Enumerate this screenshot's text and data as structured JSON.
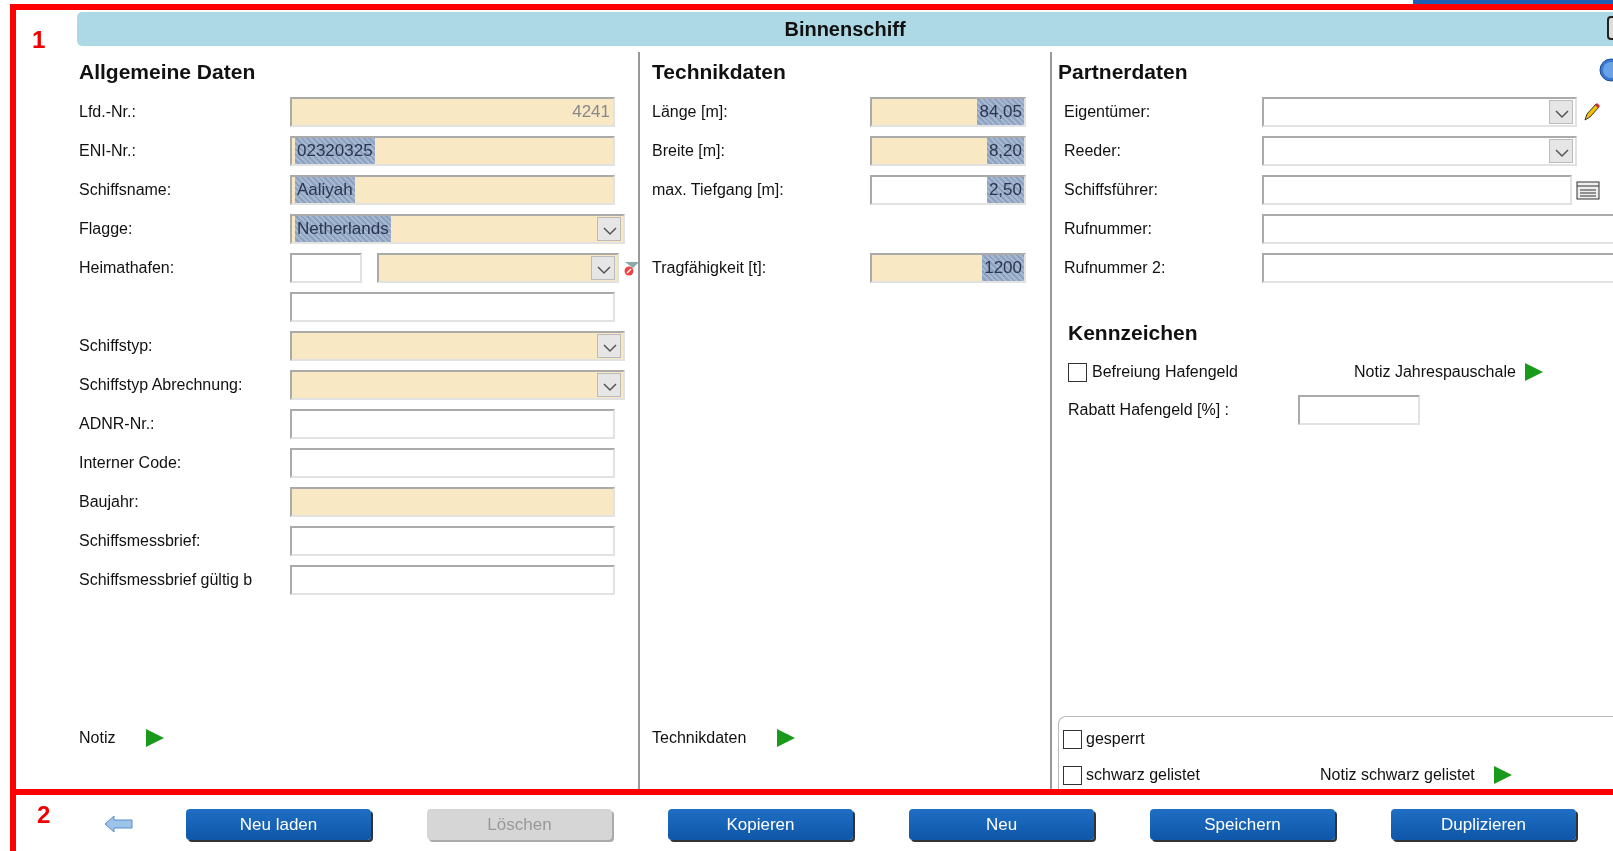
{
  "markers": [
    "1",
    "2"
  ],
  "title": "Binnenschiff",
  "general": {
    "heading": "Allgemeine Daten",
    "rows": [
      {
        "label": "Lfd.-Nr.:",
        "kind": "number",
        "value": "4241",
        "required": true,
        "highlighted": false
      },
      {
        "label": "ENI-Nr.:",
        "kind": "text",
        "value": "02320325",
        "required": true,
        "highlighted": true
      },
      {
        "label": "Schiffsname:",
        "kind": "text",
        "value": "Aaliyah",
        "required": true,
        "highlighted": true
      },
      {
        "label": "Flagge:",
        "kind": "select",
        "value": "Netherlands",
        "required": true,
        "highlighted": true
      },
      {
        "label": "Heimathafen:",
        "kind": "port",
        "fields": [
          {
            "kind": "text",
            "required": false
          },
          {
            "kind": "select",
            "required": true
          }
        ]
      },
      {
        "kind": "text",
        "required": false
      },
      {
        "label": "Schiffstyp:",
        "kind": "select",
        "required": true
      },
      {
        "label": "Schiffstyp Abrechnung:",
        "kind": "select",
        "required": true
      },
      {
        "label": "ADNR-Nr.:",
        "kind": "text",
        "required": false
      },
      {
        "label": "Interner Code:",
        "kind": "text",
        "required": false
      },
      {
        "label": "Baujahr:",
        "kind": "text",
        "required": true
      },
      {
        "label": "Schiffsmessbrief:",
        "kind": "text",
        "required": false
      },
      {
        "label": "Schiffsmessbrief gültig b",
        "kind": "text",
        "required": false
      }
    ],
    "footer_link": "Notiz"
  },
  "technical": {
    "heading": "Technikdaten",
    "rows": [
      {
        "label": "Länge [m]:",
        "kind": "number",
        "value": "84,05",
        "required": true,
        "highlighted": true
      },
      {
        "label": "Breite [m]:",
        "kind": "number",
        "value": "8,20",
        "required": true,
        "highlighted": true
      },
      {
        "label": "max. Tiefgang [m]:",
        "kind": "number",
        "value": "2,50",
        "required": false,
        "highlighted": true
      },
      {
        "label": "Tragfähigkeit [t]:",
        "kind": "number",
        "value": "1200",
        "required": true,
        "highlighted": true
      }
    ],
    "footer_link": "Technikdaten"
  },
  "partner": {
    "heading": "Partnerdaten",
    "rows": [
      {
        "label": "Eigentümer:",
        "kind": "select-edit",
        "required": false
      },
      {
        "label": "Reeder:",
        "kind": "select",
        "required": false
      },
      {
        "label": "Schiffsführer:",
        "kind": "text-lookup",
        "required": false
      },
      {
        "label": "Rufnummer:",
        "kind": "wide",
        "required": false
      },
      {
        "label": "Rufnummer 2:",
        "kind": "wide",
        "required": false
      }
    ]
  },
  "kennzeichen": {
    "heading": "Kennzeichen",
    "checkbox": {
      "label": "Befreiung Hafengeld",
      "checked": false
    },
    "link": "Notiz Jahrespauschale",
    "discount_label": "Rabatt Hafengeld [%] :"
  },
  "flags": [
    {
      "label": "gesperrt",
      "checked": false
    },
    {
      "label": "schwarz gelistet",
      "checked": false,
      "link": "Notiz schwarz gelistet"
    }
  ],
  "buttons": [
    {
      "label": "Neu laden",
      "disabled": false
    },
    {
      "label": "Löschen",
      "disabled": true
    },
    {
      "label": "Kopieren",
      "disabled": false
    },
    {
      "label": "Neu",
      "disabled": false
    },
    {
      "label": "Speichern",
      "disabled": false
    },
    {
      "label": "Duplizieren",
      "disabled": false
    }
  ]
}
